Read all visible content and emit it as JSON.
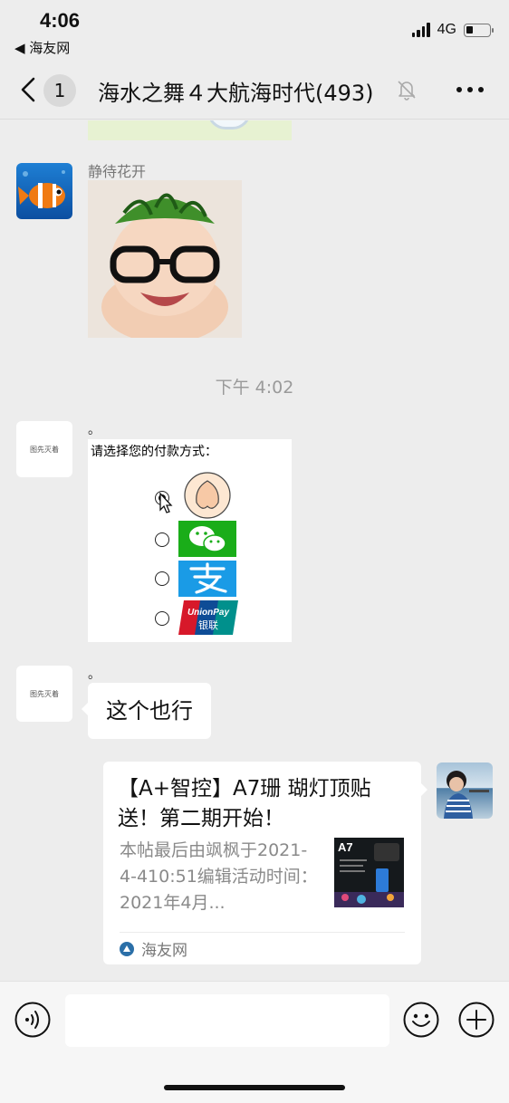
{
  "status_bar": {
    "time": "4:06",
    "back_app": "◀ 海友网",
    "network": "4G"
  },
  "nav": {
    "unread_count": "1",
    "title": "海水之舞４大航海时代(493)"
  },
  "messages": [
    {
      "type": "image",
      "sender": "静待花开"
    },
    {
      "type": "time",
      "text": "下午 4:02"
    },
    {
      "type": "image",
      "sender_text": "。",
      "avatar_text": "图先灭着",
      "image_text": "请选择您的付款方式：",
      "options": [
        "butt-emoji",
        "wechat-pay",
        "alipay",
        "unionpay"
      ],
      "selected": 0,
      "unionpay_text": "UnionPay",
      "unionpay_cn": "银联"
    },
    {
      "type": "text",
      "sender_text": "。",
      "avatar_text": "图先灭着",
      "text": "这个也行"
    },
    {
      "type": "link",
      "title": "【A+智控】A7珊 瑚灯顶贴送！第二期开始！",
      "desc": "本帖最后由飒枫于2021-4-410:51编辑活动时间：2021年4月...",
      "thumb_text": "A7",
      "source": "海友网"
    }
  ],
  "colors": {
    "background": "#ededed",
    "bubble": "#ffffff",
    "wechat_green": "#1aad19",
    "alipay_blue": "#1a9be6",
    "unionpay_red": "#d7182a"
  }
}
